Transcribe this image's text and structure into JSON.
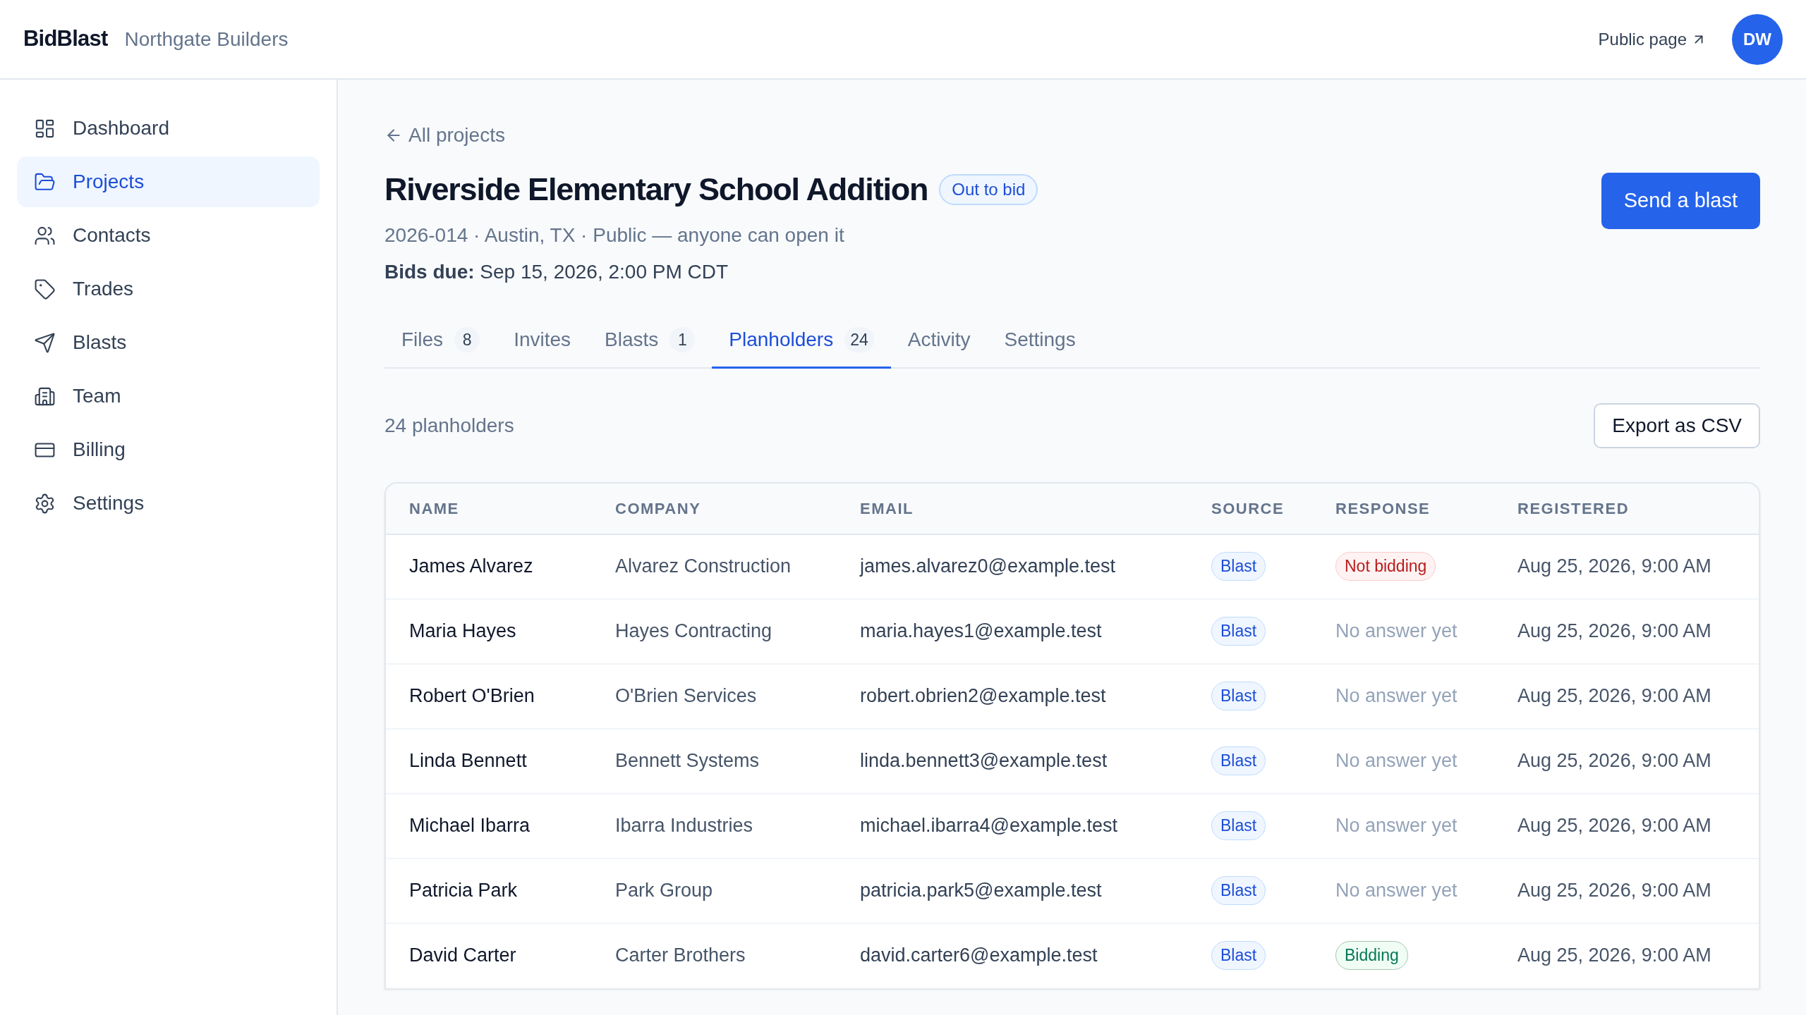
{
  "header": {
    "brand": "BidBlast",
    "org": "Northgate Builders",
    "public_link": "Public page",
    "avatar": "DW"
  },
  "sidebar": {
    "items": [
      {
        "label": "Dashboard",
        "selected": false
      },
      {
        "label": "Projects",
        "selected": true
      },
      {
        "label": "Contacts",
        "selected": false
      },
      {
        "label": "Trades",
        "selected": false
      },
      {
        "label": "Blasts",
        "selected": false
      },
      {
        "label": "Team",
        "selected": false
      },
      {
        "label": "Billing",
        "selected": false
      },
      {
        "label": "Settings",
        "selected": false
      }
    ]
  },
  "project": {
    "back_link": "All projects",
    "title": "Riverside Elementary School Addition",
    "status": "Out to bid",
    "meta": "2026-014 · Austin, TX · Public — anyone can open it",
    "due": "**Bids due:** Sep 15, 2026, 2:00 PM CDT",
    "primary_button": "Send a blast"
  },
  "tabs": [
    {
      "label": "Files",
      "count": "8",
      "selected": false
    },
    {
      "label": "Invites",
      "selected": false
    },
    {
      "label": "Blasts",
      "count": "1",
      "selected": false
    },
    {
      "label": "Planholders",
      "count": "24",
      "selected": true
    },
    {
      "label": "Activity",
      "selected": false
    },
    {
      "label": "Settings",
      "selected": false
    }
  ],
  "summary": "24 planholders",
  "export_button": "Export as CSV",
  "table": {
    "columns": [
      "NAME",
      "COMPANY",
      "EMAIL",
      "SOURCE",
      "RESPONSE",
      "REGISTERED"
    ],
    "rows": [
      {
        "name": "James Alvarez",
        "company": "Alvarez Construction",
        "email": "james.alvarez0@example.test",
        "source": "Blast",
        "response": {
          "kind": "not_bidding",
          "text": "Not bidding"
        },
        "registered": "Aug 25, 2026, 9:00 AM"
      },
      {
        "name": "Maria Hayes",
        "company": "Hayes Contracting",
        "email": "maria.hayes1@example.test",
        "source": "Blast",
        "response": {
          "kind": "pending",
          "text": "No answer yet"
        },
        "registered": "Aug 25, 2026, 9:00 AM"
      },
      {
        "name": "Robert O'Brien",
        "company": "O'Brien Services",
        "email": "robert.obrien2@example.test",
        "source": "Blast",
        "response": {
          "kind": "pending",
          "text": "No answer yet"
        },
        "registered": "Aug 25, 2026, 9:00 AM"
      },
      {
        "name": "Linda Bennett",
        "company": "Bennett Systems",
        "email": "linda.bennett3@example.test",
        "source": "Blast",
        "response": {
          "kind": "pending",
          "text": "No answer yet"
        },
        "registered": "Aug 25, 2026, 9:00 AM"
      },
      {
        "name": "Michael Ibarra",
        "company": "Ibarra Industries",
        "email": "michael.ibarra4@example.test",
        "source": "Blast",
        "response": {
          "kind": "pending",
          "text": "No answer yet"
        },
        "registered": "Aug 25, 2026, 9:00 AM"
      },
      {
        "name": "Patricia Park",
        "company": "Park Group",
        "email": "patricia.park5@example.test",
        "source": "Blast",
        "response": {
          "kind": "pending",
          "text": "No answer yet"
        },
        "registered": "Aug 25, 2026, 9:00 AM"
      },
      {
        "name": "David Carter",
        "company": "Carter Brothers",
        "email": "david.carter6@example.test",
        "source": "Blast",
        "response": {
          "kind": "bidding",
          "text": "Bidding"
        },
        "registered": "Aug 25, 2026, 9:00 AM"
      }
    ]
  }
}
